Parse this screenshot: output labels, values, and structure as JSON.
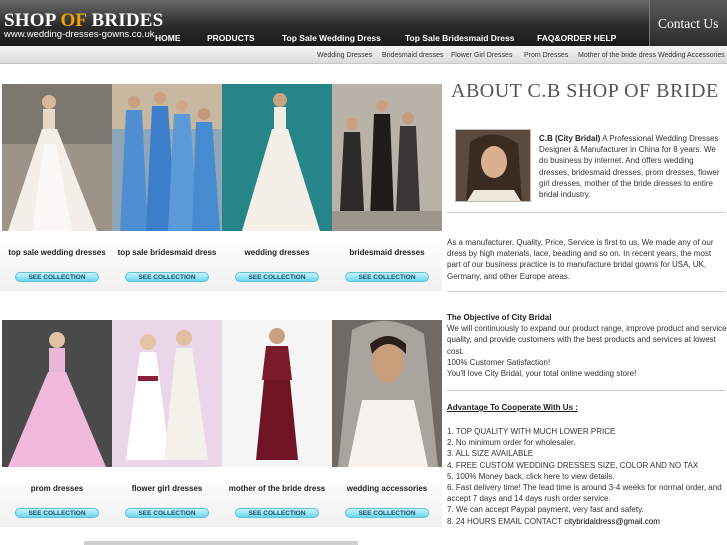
{
  "header": {
    "logo_part1": "SHOP ",
    "logo_part2": "OF",
    "logo_part3": " BRIDES",
    "logo_url": "www.wedding-dresses-gowns.co.uk",
    "contact_label": "Contact Us",
    "nav": [
      "HOME",
      "PRODUCTS",
      "Top Sale Wedding Dress",
      "Top Sale Bridesmaid Dress",
      "FAQ&ORDER HELP"
    ]
  },
  "subnav": [
    "Wedding Dresses",
    "Bridesmaid dresses",
    "Flower Girl Dresses",
    "Prom Dresses",
    "Mother of the bride dress",
    "Wedding Accessories"
  ],
  "gallery": {
    "row1": [
      {
        "caption": "top sale wedding dresses",
        "button": "SEE COLLECTION"
      },
      {
        "caption": "top sale bridesmaid dress",
        "button": "SEE COLLECTION"
      },
      {
        "caption": "wedding dresses",
        "button": "SEE COLLECTION"
      },
      {
        "caption": "bridesmaid dresses",
        "button": "SEE COLLECTION"
      }
    ],
    "row2": [
      {
        "caption": "prom dresses",
        "button": "SEE COLLECTION"
      },
      {
        "caption": "flower girl dresses",
        "button": "SEE COLLECTION"
      },
      {
        "caption": "mother of the bride dress",
        "button": "SEE COLLECTION"
      },
      {
        "caption": "wedding accessories",
        "button": "SEE COLLECTION"
      }
    ]
  },
  "about": {
    "title": "ABOUT C.B SHOP OF BRIDE",
    "intro_bold": "C.B (City Bridal)",
    "intro_text": " A Professional Wedding Dresses Designer & Manufacturer in China for 8 years. We do business by internet. And offers wedding dresses, bridesmaid dresses, prom dresses, flower girl dresses, mother of the bride dresses to entire bridal industry.",
    "paragraph2": "As a manufacturer, Quality, Price, Service is first to us. We made any of our dress by high materials, lace, beading and so on. In recent years, the most part of our business practice is to manufacture bridal gowns for USA, UK, Germany, and other Europe areas.",
    "objective_title": "The Objective of City Bridal",
    "objective_text": "We will continuously to expand our product range, improve product and service quality, and provide customers with the best products and services at lowest cost.",
    "objective_line2": "100% Customer Satisfaction!",
    "objective_line3": "You'll love City Bridal, your total online wedding store!",
    "advantage_title": "Advantage To Cooperate With Us :",
    "advantages": [
      "1. TOP QUALITY WITH MUCH LOWER PRICE",
      "2. No minimum order for wholesaler.",
      "3. ALL SIZE AVAILABLE",
      "4. FREE CUSTOM WEDDING DRESSES SIZE, COLOR AND NO TAX",
      "5. 100% Money back, click here to view details.",
      "6. Fast delivery time! The lead time is around 3-4 weeks for normal order, and accept 7 days and 14 days rush order service.",
      "7. We can accept Paypal payment, very fast and safety."
    ],
    "email_prefix": "8. 24 HOURS EMAIL CONTACT ",
    "email": "citybridaldress@gmail.com"
  },
  "colors": {
    "header_dark": "#1a1a1a",
    "logo_accent": "#f0a500",
    "button_cyan": "#6cd6ee"
  }
}
